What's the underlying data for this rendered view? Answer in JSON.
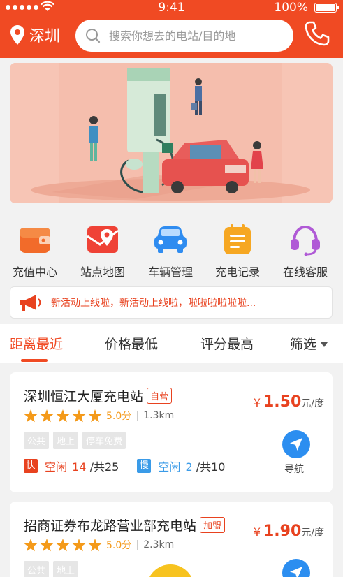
{
  "status_bar": {
    "time": "9:41",
    "battery": "100%"
  },
  "header": {
    "city": "深圳",
    "search_placeholder": "搜索你想去的电站/目的地"
  },
  "quick_actions": [
    {
      "label": "充值中心",
      "icon": "wallet-icon",
      "color": "#f26b2a"
    },
    {
      "label": "站点地图",
      "icon": "map-icon",
      "color": "#ef4236"
    },
    {
      "label": "车辆管理",
      "icon": "car-icon",
      "color": "#2f8cf0"
    },
    {
      "label": "充电记录",
      "icon": "record-icon",
      "color": "#f6a722"
    },
    {
      "label": "在线客服",
      "icon": "headset-icon",
      "color": "#b05ad6"
    }
  ],
  "notice": {
    "text": "新活动上线啦，新活动上线啦，啦啦啦啦啦啦..."
  },
  "sort_tabs": [
    {
      "label": "距离最近"
    },
    {
      "label": "价格最低"
    },
    {
      "label": "评分最高"
    },
    {
      "label": "筛选"
    }
  ],
  "stations": [
    {
      "name": "深圳恒江大厦充电站",
      "badge": "自营",
      "rating_stars": 5,
      "score": "5.0分",
      "distance": "1.3km",
      "tags": [
        "公共",
        "地上",
        "停车免费"
      ],
      "price_currency": "¥",
      "price": "1.50",
      "price_unit": "元/度",
      "fast": {
        "badge": "快",
        "idle_label": "空闲",
        "idle": "14",
        "total": "/共25"
      },
      "slow": {
        "badge": "慢",
        "idle_label": "空闲",
        "idle": "2",
        "total": "/共10"
      },
      "nav_label": "导航"
    },
    {
      "name": "招商证券布龙路营业部充电站",
      "badge": "加盟",
      "rating_stars": 5,
      "score": "5.0分",
      "distance": "2.3km",
      "tags": [
        "公共",
        "地上"
      ],
      "price_currency": "¥",
      "price": "1.90",
      "price_unit": "元/度"
    }
  ],
  "colors": {
    "brand": "#f04a23",
    "star": "#f49a1a",
    "fast": "#e8421f",
    "slow": "#3a9be8",
    "nav": "#2c8ef0"
  }
}
